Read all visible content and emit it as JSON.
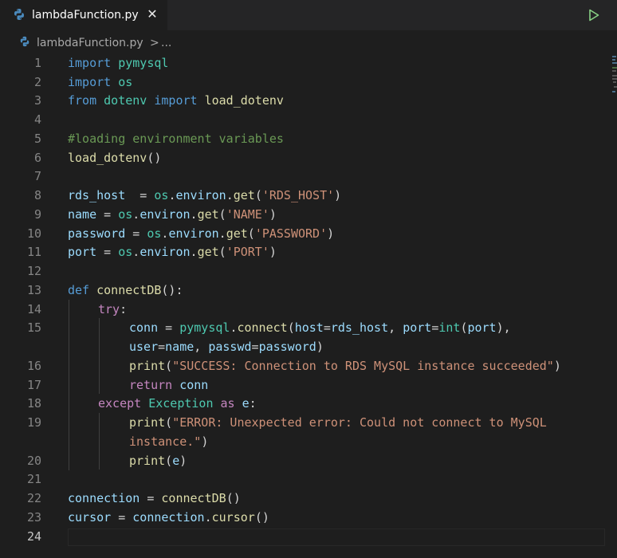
{
  "tab": {
    "label": "lambdaFunction.py",
    "close": "✕",
    "file_icon": "python-icon"
  },
  "toolbar": {
    "run_icon": "run-play-icon"
  },
  "breadcrumb": {
    "file": "lambdaFunction.py",
    "separator": ">",
    "more": "..."
  },
  "editor": {
    "line_numbers": [
      "1",
      "2",
      "3",
      "4",
      "5",
      "6",
      "7",
      "8",
      "9",
      "10",
      "11",
      "12",
      "13",
      "14",
      "15",
      "16",
      "17",
      "18",
      "19",
      "20",
      "21",
      "22",
      "23",
      "24"
    ],
    "active_line": "24",
    "code": {
      "l1_kw": "import",
      "l1_mod": "pymysql",
      "l2_kw": "import",
      "l2_mod": "os",
      "l3_kw1": "from",
      "l3_mod": "dotenv",
      "l3_kw2": "import",
      "l3_fn": "load_dotenv",
      "l5_cmt": "#loading environment variables",
      "l6_fn": "load_dotenv",
      "l6_rest": "()",
      "l8_var": "rds_host",
      "l8_eq": "  = ",
      "l8_mod": "os",
      "l8_dot": ".",
      "l8_attr": "environ",
      "l8_dot2": ".",
      "l8_fn": "get",
      "l8_p1": "(",
      "l8_str": "'RDS_HOST'",
      "l8_p2": ")",
      "l9_var": "name",
      "l9_eq": " = ",
      "l9_mod": "os",
      "l9_attr": "environ",
      "l9_fn": "get",
      "l9_str": "'NAME'",
      "l10_var": "password",
      "l10_eq": " = ",
      "l10_mod": "os",
      "l10_attr": "environ",
      "l10_fn": "get",
      "l10_str": "'PASSWORD'",
      "l11_var": "port",
      "l11_eq": " = ",
      "l11_mod": "os",
      "l11_attr": "environ",
      "l11_fn": "get",
      "l11_str": "'PORT'",
      "l13_kw": "def",
      "l13_fn": "connectDB",
      "l13_rest": "():",
      "l14_kw": "try",
      "l14_rest": ":",
      "l15_var1": "conn",
      "l15_eq": " = ",
      "l15_mod": "pymysql",
      "l15_fn": "connect",
      "l15_p": "(",
      "l15_a1": "host",
      "l15_v1": "rds_host",
      "l15_a2": "port",
      "l15_int": "int",
      "l15_v2": "port",
      "l15_end": "),",
      "l15b_a1": "user",
      "l15b_v1": "name",
      "l15b_a2": "passwd",
      "l15b_v2": "password",
      "l15b_end": ")",
      "l16_fn": "print",
      "l16_str": "\"SUCCESS: Connection to RDS MySQL instance succeeded\"",
      "l17_kw": "return",
      "l17_var": "conn",
      "l18_kw": "except",
      "l18_cls": "Exception",
      "l18_kw2": "as",
      "l18_var": "e",
      "l19_fn": "print",
      "l19_str": "\"ERROR: Unexpected error: Could not connect to MySQL",
      "l19b_str": "instance.\"",
      "l20_fn": "print",
      "l20_var": "e",
      "l22_var": "connection",
      "l22_eq": " = ",
      "l22_fn": "connectDB",
      "l22_rest": "()",
      "l23_var": "cursor",
      "l23_eq": " = ",
      "l23_var2": "connection",
      "l23_fn": "cursor",
      "l23_rest": "()"
    }
  },
  "colors": {
    "background": "#1e1e1e",
    "tabbar": "#252526",
    "keyword": "#569cd6",
    "control": "#c586c0",
    "module": "#4ec9b0",
    "function": "#dcdcaa",
    "variable": "#9cdcfe",
    "string": "#ce9178",
    "comment": "#6a9955",
    "run": "#89d185"
  }
}
